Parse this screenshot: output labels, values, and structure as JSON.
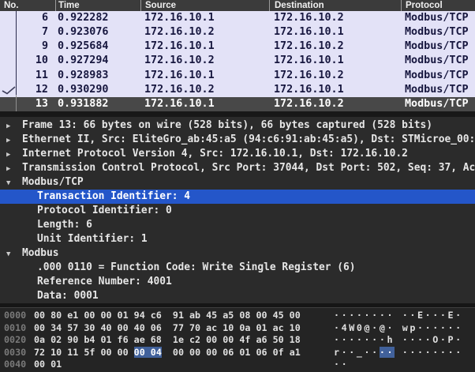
{
  "colors": {
    "list_row_bg": "#e3e2f7",
    "list_text": "#17173f",
    "selected_row_bg": "#484848",
    "header_bg": "#3b3b3b",
    "details_bg": "#2b2b2b",
    "detail_selection_blue": "#2456c9",
    "hex_bg": "#242424",
    "hex_offset_gray": "#7a7a7a",
    "hex_highlight_blue": "#41619b"
  },
  "packet_list": {
    "columns": [
      "No.",
      "Time",
      "Source",
      "Destination",
      "Protocol"
    ],
    "rows": [
      {
        "no": "6",
        "time": "0.922282",
        "source": "172.16.10.1",
        "destination": "172.16.10.2",
        "protocol": "Modbus/TCP",
        "selected": false
      },
      {
        "no": "7",
        "time": "0.923076",
        "source": "172.16.10.2",
        "destination": "172.16.10.1",
        "protocol": "Modbus/TCP",
        "selected": false
      },
      {
        "no": "9",
        "time": "0.925684",
        "source": "172.16.10.1",
        "destination": "172.16.10.2",
        "protocol": "Modbus/TCP",
        "selected": false
      },
      {
        "no": "10",
        "time": "0.927294",
        "source": "172.16.10.2",
        "destination": "172.16.10.1",
        "protocol": "Modbus/TCP",
        "selected": false
      },
      {
        "no": "11",
        "time": "0.928983",
        "source": "172.16.10.1",
        "destination": "172.16.10.2",
        "protocol": "Modbus/TCP",
        "selected": false
      },
      {
        "no": "12",
        "time": "0.930290",
        "source": "172.16.10.2",
        "destination": "172.16.10.1",
        "protocol": "Modbus/TCP",
        "selected": false
      },
      {
        "no": "13",
        "time": "0.931882",
        "source": "172.16.10.1",
        "destination": "172.16.10.2",
        "protocol": "Modbus/TCP",
        "selected": true
      }
    ]
  },
  "details": {
    "items": [
      {
        "icon": "collapsed",
        "level": 0,
        "selected": false,
        "text": "Frame 13: 66 bytes on wire (528 bits), 66 bytes captured (528 bits)"
      },
      {
        "icon": "collapsed",
        "level": 0,
        "selected": false,
        "text": "Ethernet II, Src: EliteGro_ab:45:a5 (94:c6:91:ab:45:a5), Dst: STMicroe_00:"
      },
      {
        "icon": "collapsed",
        "level": 0,
        "selected": false,
        "text": "Internet Protocol Version 4, Src: 172.16.10.1, Dst: 172.16.10.2"
      },
      {
        "icon": "collapsed",
        "level": 0,
        "selected": false,
        "text": "Transmission Control Protocol, Src Port: 37044, Dst Port: 502, Seq: 37, Ac"
      },
      {
        "icon": "expanded",
        "level": 0,
        "selected": false,
        "text": "Modbus/TCP"
      },
      {
        "icon": "none",
        "level": 1,
        "selected": true,
        "text": "Transaction Identifier: 4"
      },
      {
        "icon": "none",
        "level": 1,
        "selected": false,
        "text": "Protocol Identifier: 0"
      },
      {
        "icon": "none",
        "level": 1,
        "selected": false,
        "text": "Length: 6"
      },
      {
        "icon": "none",
        "level": 1,
        "selected": false,
        "text": "Unit Identifier: 1"
      },
      {
        "icon": "expanded",
        "level": 0,
        "selected": false,
        "text": "Modbus"
      },
      {
        "icon": "none",
        "level": 1,
        "selected": false,
        "text": ".000 0110 = Function Code: Write Single Register (6)"
      },
      {
        "icon": "none",
        "level": 1,
        "selected": false,
        "text": "Reference Number: 4001"
      },
      {
        "icon": "none",
        "level": 1,
        "selected": false,
        "text": "Data: 0001"
      }
    ]
  },
  "hex_dump": {
    "rows": [
      {
        "offset": "0000",
        "hex": [
          {
            "t": "00 80 e1 00 00 01 94 c6  91 ab 45 a5 08 00 45 00",
            "sel": false
          }
        ],
        "ascii": [
          {
            "t": "········ ··E···E·",
            "sel": false
          }
        ]
      },
      {
        "offset": "0010",
        "hex": [
          {
            "t": "00 34 57 30 40 00 40 06  77 70 ac 10 0a 01 ac 10",
            "sel": false
          }
        ],
        "ascii": [
          {
            "t": "·4W0@·@· wp······",
            "sel": false
          }
        ]
      },
      {
        "offset": "0020",
        "hex": [
          {
            "t": "0a 02 90 b4 01 f6 ae 68  1e c2 00 00 4f a6 50 18",
            "sel": false
          }
        ],
        "ascii": [
          {
            "t": "·······h ····O·P·",
            "sel": false
          }
        ]
      },
      {
        "offset": "0030",
        "hex": [
          {
            "t": "72 10 11 5f 00 00 ",
            "sel": false
          },
          {
            "t": "00 04",
            "sel": true
          },
          {
            "t": "  00 00 00 06 01 06 0f a1",
            "sel": false
          }
        ],
        "ascii": [
          {
            "t": "r··_··",
            "sel": false
          },
          {
            "t": "··",
            "sel": true
          },
          {
            "t": " ········",
            "sel": false
          }
        ]
      },
      {
        "offset": "0040",
        "hex": [
          {
            "t": "00 01",
            "sel": false
          }
        ],
        "ascii": [
          {
            "t": "··",
            "sel": false
          }
        ]
      }
    ]
  }
}
